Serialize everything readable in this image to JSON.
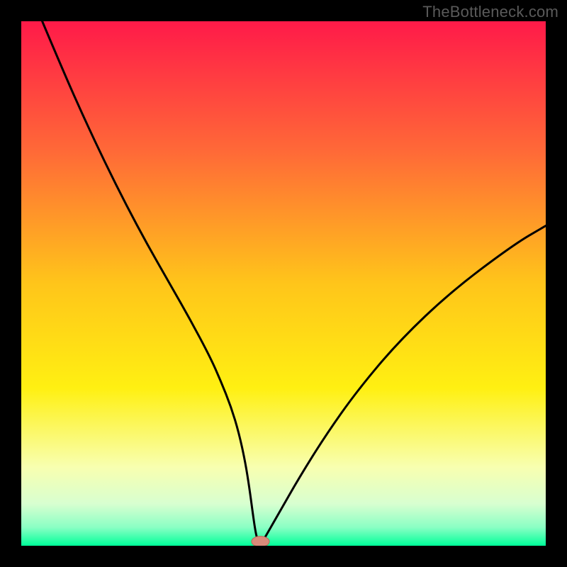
{
  "watermark": "TheBottleneck.com",
  "chart_data": {
    "type": "line",
    "title": "",
    "xlabel": "",
    "ylabel": "",
    "xlim": [
      0,
      100
    ],
    "ylim": [
      0,
      100
    ],
    "axes_visible": false,
    "grid": false,
    "background_gradient": {
      "stops": [
        {
          "offset": 0.0,
          "color": "#ff1a49"
        },
        {
          "offset": 0.25,
          "color": "#ff6a37"
        },
        {
          "offset": 0.5,
          "color": "#ffc51a"
        },
        {
          "offset": 0.7,
          "color": "#fff012"
        },
        {
          "offset": 0.85,
          "color": "#f8ffb0"
        },
        {
          "offset": 0.92,
          "color": "#d8ffd0"
        },
        {
          "offset": 0.965,
          "color": "#8affc4"
        },
        {
          "offset": 1.0,
          "color": "#00ff9a"
        }
      ]
    },
    "frame": {
      "color": "#000000",
      "thickness_px": 30
    },
    "curve": {
      "color": "#000000",
      "thickness_px": 3,
      "x": [
        4,
        8,
        12,
        16,
        20,
        24,
        28,
        32,
        36,
        38,
        40,
        41.5,
        42.7,
        43.5,
        44.1,
        44.6,
        45,
        45.5,
        46,
        47,
        49,
        53,
        58,
        64,
        72,
        82,
        94,
        100
      ],
      "y": [
        100,
        90.5,
        81.5,
        73,
        65,
        57.5,
        50.5,
        43.5,
        36,
        31.5,
        26.5,
        21.5,
        16,
        11,
        6.5,
        3,
        1.2,
        0.5,
        0.8,
        2.5,
        6,
        13,
        21,
        29.5,
        39,
        48.5,
        57.5,
        61
      ]
    },
    "marker": {
      "x": 45.6,
      "y": 0.8,
      "rx": 1.7,
      "ry": 1.0,
      "fill": "#d98a7a",
      "stroke": "#b86a5a"
    }
  }
}
